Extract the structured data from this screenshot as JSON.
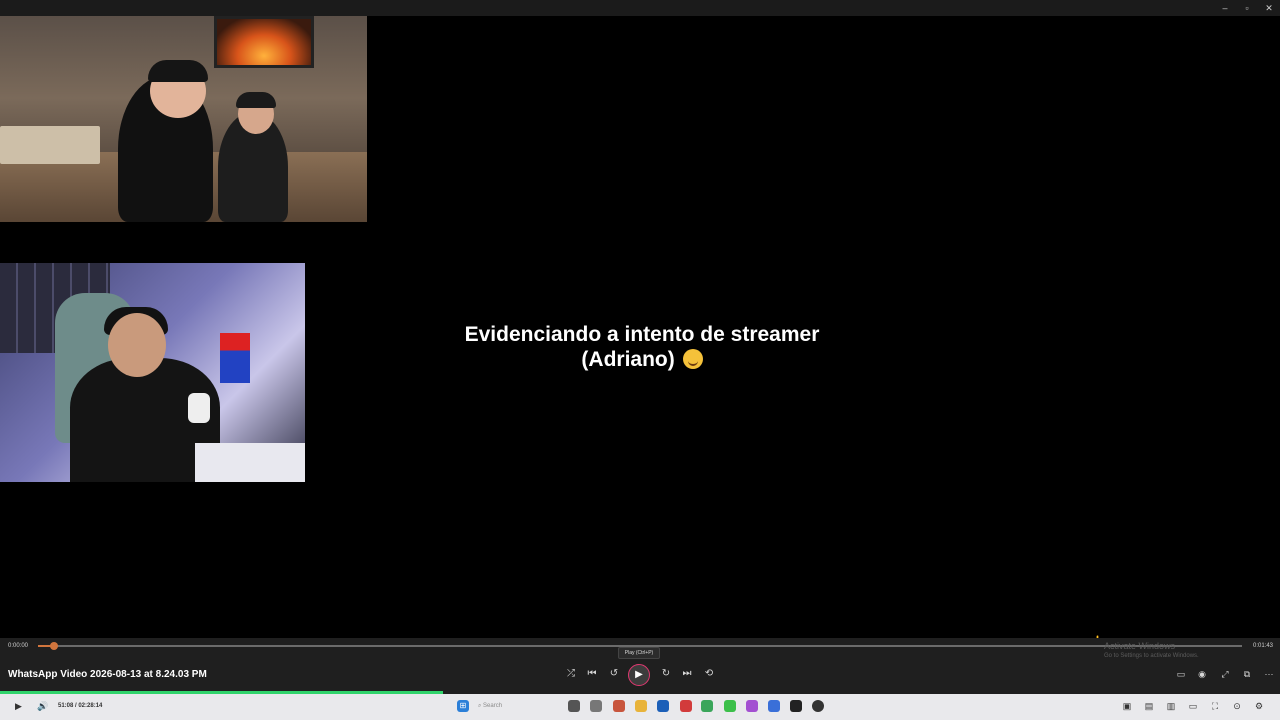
{
  "window": {
    "minimize": "–",
    "restore": "▫",
    "close": "✕"
  },
  "video": {
    "caption_line1": "Evidenciando a intento de streamer",
    "caption_line2": "(Adriano)",
    "caption_emoji": "rolling-on-floor-laughing-emoji"
  },
  "player": {
    "title": "WhatsApp Video 2026-08-13 at 8.24.03 PM",
    "current_time": "0:00:00",
    "total_time": "0:01:43",
    "seek_progress": 0.013,
    "tooltip": "Play (Ctrl+P)",
    "controls": {
      "shuffle": "⤮",
      "previous": "⏮",
      "rewind": "↺",
      "play": "▶",
      "forward": "↻",
      "next": "⏭",
      "repeat": "⟲"
    },
    "right_controls": {
      "subtitles": "▭",
      "audio": "◉",
      "fullscreen": "⤢",
      "miniplayer": "⧉",
      "more": "···"
    },
    "activate_windows_title": "Activate Windows",
    "activate_windows_sub": "Go to Settings to activate Windows."
  },
  "outer_player": {
    "time": "51:08 / 02:28:14",
    "outer_progress": 0.346,
    "play": "▶",
    "volume": "🔊",
    "search_placeholder": "Search"
  },
  "colors": {
    "accent": "#d1753d",
    "green": "#31d46c",
    "play_ring": "#e03870"
  }
}
